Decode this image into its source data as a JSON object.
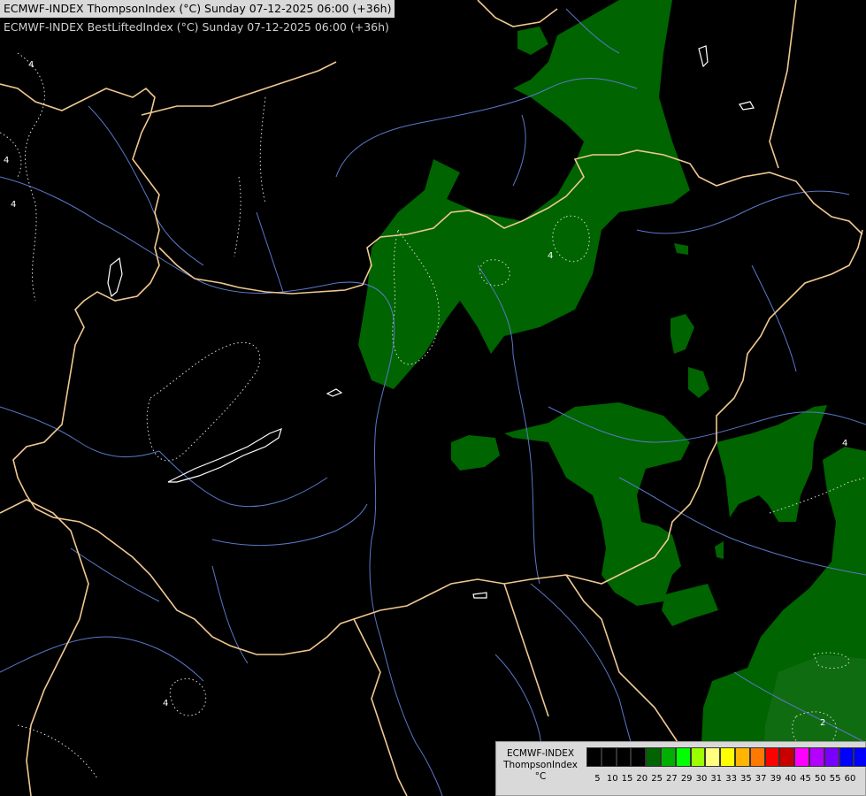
{
  "header": {
    "line1": "ECMWF-INDEX ThompsonIndex (°C) Sunday 07-12-2025 06:00 (+36h)",
    "line2": "ECMWF-INDEX BestLiftedIndex (°C) Sunday 07-12-2025 06:00 (+36h)"
  },
  "legend": {
    "model": "ECMWF-INDEX",
    "parameter": "ThompsonIndex",
    "unit": "°C",
    "ticks": [
      "5",
      "10",
      "15",
      "20",
      "25",
      "27",
      "29",
      "30",
      "31",
      "33",
      "35",
      "37",
      "39",
      "40",
      "45",
      "50",
      "55",
      "60"
    ],
    "colors": [
      "#000000",
      "#000000",
      "#000000",
      "#000000",
      "#006400",
      "#00b000",
      "#00ff00",
      "#9cff00",
      "#ffff7f",
      "#ffff00",
      "#ffb400",
      "#ff7800",
      "#ff0000",
      "#c80000",
      "#ff00ff",
      "#b400ff",
      "#7800ff",
      "#0000ff",
      "#0000ff"
    ]
  },
  "contour_labels": [
    "4",
    "4",
    "4",
    "4",
    "4",
    "4",
    "2"
  ],
  "colors": {
    "background": "#000000",
    "fill_25": "#006400",
    "fill_lowlight": "#3c8a3c",
    "border": "#f0c890",
    "river": "#5a78c8",
    "contour": "#dcdcdc"
  }
}
